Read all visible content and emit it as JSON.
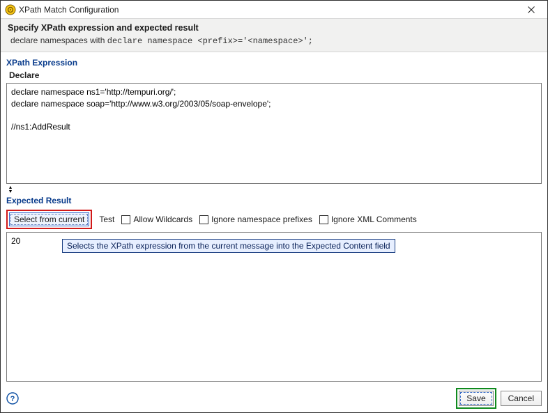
{
  "titlebar": {
    "title": "XPath Match Configuration"
  },
  "header": {
    "main": "Specify XPath expression and expected result",
    "sub_prefix": "declare namespaces with ",
    "sub_mono": "declare namespace <prefix>='<namespace>';"
  },
  "xpath": {
    "section_title": "XPath Expression",
    "declare_label": "Declare",
    "value": "declare namespace ns1='http://tempuri.org/';\ndeclare namespace soap='http://www.w3.org/2003/05/soap-envelope';\n\n//ns1:AddResult"
  },
  "expected": {
    "section_title": "Expected Result",
    "select_button": "Select from current",
    "test_link": "Test",
    "allow_wildcards": "Allow Wildcards",
    "ignore_ns": "Ignore namespace prefixes",
    "ignore_comments": "Ignore XML Comments",
    "value": "20",
    "tooltip": "Selects the XPath expression from the current message into the Expected Content field"
  },
  "footer": {
    "save": "Save",
    "cancel": "Cancel"
  }
}
